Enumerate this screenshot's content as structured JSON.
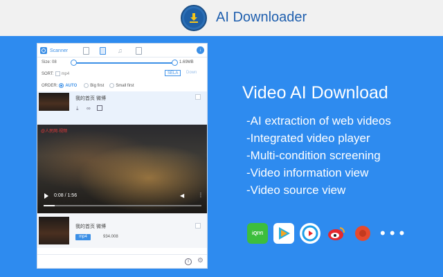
{
  "header": {
    "app_title": "AI Downloader",
    "logo_icon": "download-icon"
  },
  "panel": {
    "tabs": {
      "scanner": "Scanner"
    },
    "size_label": "Size: 08",
    "size_max": "1.69MB",
    "sort_label": "SORT:",
    "sort_option": "mp4",
    "sel_all": "SELA",
    "down": "Down",
    "order_label": "ORDER:",
    "order_auto": "AUTO",
    "order_big": "Big first",
    "order_small": "Small first",
    "items": [
      {
        "title": "我的首页 微博"
      },
      {
        "title": "我的首页 微博",
        "format": "mp4",
        "size": "934.008"
      }
    ],
    "video": {
      "time": "0:08 / 1:56",
      "progress": 0.07,
      "channel": "@人民网·视频"
    }
  },
  "right": {
    "headline": "Video AI Download",
    "features": [
      "-AI extraction of web videos",
      "-Integrated video player",
      "-Multi-condition screening",
      "-Video information view",
      "-Video source view"
    ],
    "sites": [
      {
        "label": "iQIYI",
        "icon": "iqiyi-icon",
        "color": "#3DBE3D"
      },
      {
        "label": "",
        "icon": "tencent-video-icon",
        "color": "#27AEDB"
      },
      {
        "label": "",
        "icon": "youku-icon",
        "color": "#1D9EE8"
      },
      {
        "label": "",
        "icon": "weibo-icon",
        "color": "#E6282C"
      },
      {
        "label": "",
        "icon": "mango-icon",
        "color": "#E64A2D"
      }
    ],
    "more": "• • •"
  }
}
